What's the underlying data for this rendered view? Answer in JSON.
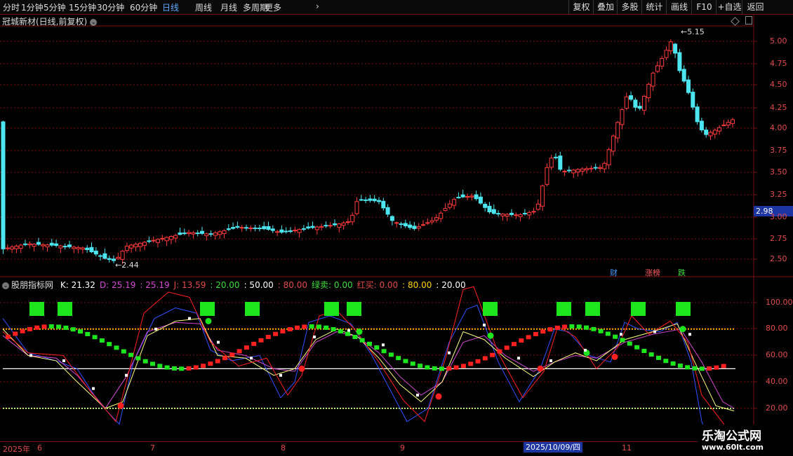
{
  "periods": [
    "分时",
    "1分钟",
    "5分钟",
    "15分钟",
    "30分钟",
    "60分钟",
    "日线",
    "周线",
    "月线",
    "多周期",
    "更多"
  ],
  "active_period": "日线",
  "right_buttons": [
    "复权",
    "叠加",
    "多股",
    "统计",
    "画线",
    "F10",
    "+自选",
    "返回"
  ],
  "stock_title": "冠城新材(日线,前复权)",
  "price_axis": [
    "5.00",
    "4.75",
    "4.50",
    "4.25",
    "4.00",
    "3.75",
    "3.50",
    "3.25",
    "3.00",
    "2.75",
    "2.50"
  ],
  "current_price": "2.98",
  "high_label": "5.15",
  "low_label": "2.44",
  "event_markers": [
    {
      "text": "财",
      "color": "#4a9cff"
    },
    {
      "text": "涨榜",
      "color": "#ff5a5a"
    },
    {
      "text": "跌",
      "color": "#3ddc3d"
    }
  ],
  "indicator": {
    "name": "股朋指标网",
    "values": [
      {
        "label": "K: 21.32",
        "color": "#ffffff"
      },
      {
        "label": "D: 25.19",
        "color": "#d34ad3"
      },
      {
        "label": ": 25.19",
        "color": "#d34ad3"
      },
      {
        "label": "J: 13.59",
        "color": "#e24b4b"
      },
      {
        "label": ": 20.00",
        "color": "#3ddc3d"
      },
      {
        "label": ": 50.00",
        "color": "#ffffff"
      },
      {
        "label": ": 80.00",
        "color": "#e24b4b"
      },
      {
        "label": "绿卖: 0.00",
        "color": "#3ddc3d"
      },
      {
        "label": "红买: 0.00",
        "color": "#e24b4b"
      },
      {
        "label": ": 80.00",
        "color": "#ffd400"
      },
      {
        "label": ": 20.00",
        "color": "#ffffff"
      }
    ],
    "axis": [
      "100.00",
      "80.00",
      "60.00",
      "40.00",
      "20.00"
    ]
  },
  "date_axis": [
    "2025年",
    "6",
    "7",
    "8",
    "9",
    "10",
    "11"
  ],
  "selected_date": "2025/10/09/四",
  "watermark": {
    "name": "乐淘公式网",
    "url": "www.60lt.com"
  },
  "colors": {
    "up": "#ff3b3b",
    "down": "#4de6f0",
    "grid": "#7a1010",
    "green": "#1ee61e"
  }
}
